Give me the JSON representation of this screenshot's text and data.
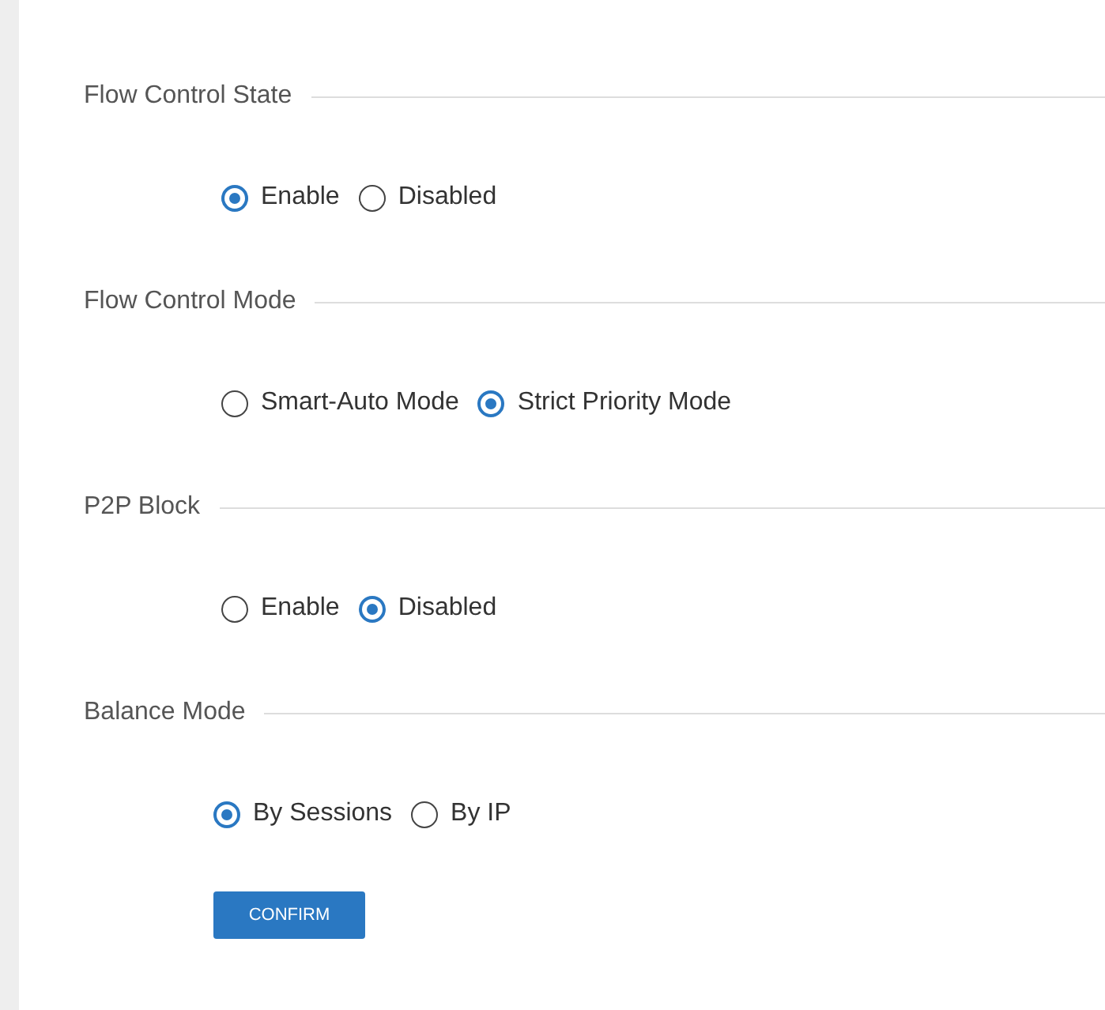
{
  "sections": [
    {
      "title": "Flow Control State",
      "options": [
        {
          "label": "Enable",
          "selected": true
        },
        {
          "label": "Disabled",
          "selected": false
        }
      ]
    },
    {
      "title": "Flow Control Mode",
      "options": [
        {
          "label": "Smart-Auto Mode",
          "selected": false
        },
        {
          "label": "Strict Priority Mode",
          "selected": true
        }
      ]
    },
    {
      "title": "P2P Block",
      "options": [
        {
          "label": "Enable",
          "selected": false
        },
        {
          "label": "Disabled",
          "selected": true
        }
      ]
    },
    {
      "title": "Balance Mode",
      "options": [
        {
          "label": "By Sessions",
          "selected": true
        },
        {
          "label": "By IP",
          "selected": false
        }
      ]
    }
  ],
  "confirm_button": "CONFIRM"
}
